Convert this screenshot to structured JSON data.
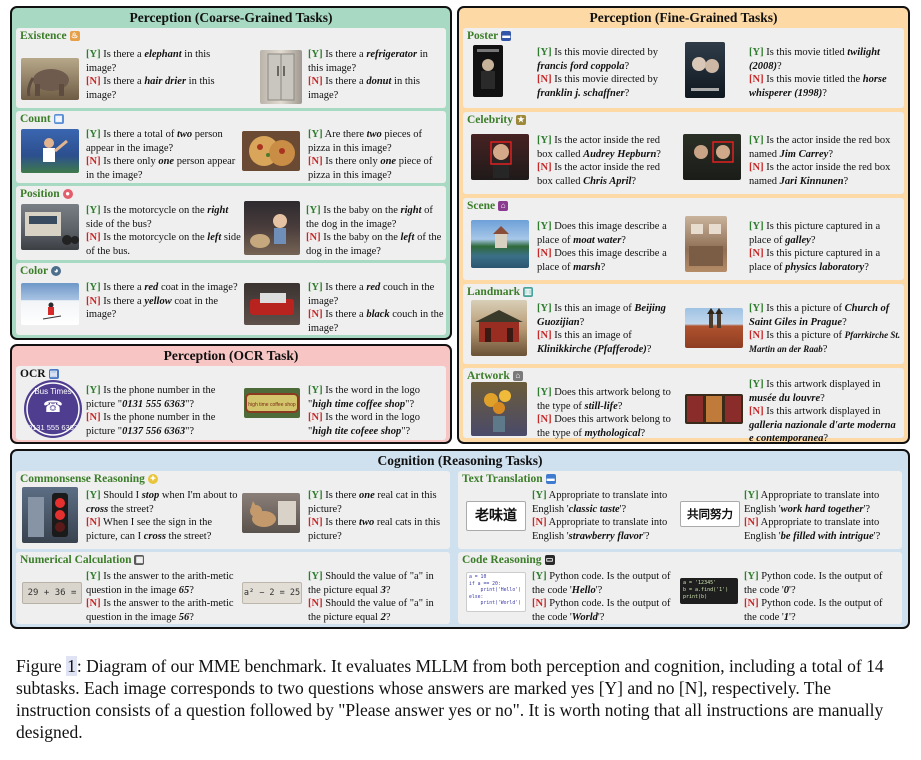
{
  "panels": {
    "coarse": {
      "title": "Perception (Coarse-Grained Tasks)",
      "bg": "#a8d9c3"
    },
    "fine": {
      "title": "Perception (Fine-Grained Tasks)",
      "bg": "#fcd9a5"
    },
    "ocr": {
      "title": "Perception (OCR Task)",
      "bg": "#f7c6c4"
    },
    "cognition": {
      "title": "Cognition (Reasoning Tasks)",
      "bg": "#cfe0ef"
    }
  },
  "tags": {
    "y": "[Y]",
    "n": "[N]"
  },
  "existence": {
    "name": "Existence",
    "a": {
      "y1": " Is there a ",
      "yk": "elephant",
      "y2": " in this image?",
      "n1": " Is there a ",
      "nk": "hair drier",
      "n2": " in this image?"
    },
    "b": {
      "y1": " Is there a ",
      "yk": "refrigerator",
      "y2": " in this image?",
      "n1": " Is there a ",
      "nk": "donut",
      "n2": " in this image?"
    }
  },
  "count": {
    "name": "Count",
    "a": {
      "y1": " Is there a total of ",
      "yk": "two",
      "y2": " person appear in the image?",
      "n1": " Is there only ",
      "nk": "one",
      "n2": " person appear in the image?"
    },
    "b": {
      "y1": " Are there ",
      "yk": "two",
      "y2": " pieces of pizza in this image?",
      "n1": " Is there only ",
      "nk": "one",
      "n2": " piece of pizza in this image?"
    }
  },
  "position": {
    "name": "Position",
    "a": {
      "y1": " Is the motorcycle on the ",
      "yk": "right",
      "y2": " side of the bus?",
      "n1": " Is the motorcycle on the ",
      "nk": "left",
      "n2": " side of the bus."
    },
    "b": {
      "y1": " Is the baby on the ",
      "yk": "right",
      "y2": " of the dog in the image?",
      "n1": " Is the baby on the ",
      "nk": "left",
      "n2": " of the dog in the image?"
    }
  },
  "color": {
    "name": "Color",
    "a": {
      "y1": " Is there a ",
      "yk": "red",
      "y2": " coat in the image?",
      "n1": " Is there a ",
      "nk": "yellow",
      "n2": " coat in the image?"
    },
    "b": {
      "y1": " Is there a ",
      "yk": "red",
      "y2": " couch in the image?",
      "n1": " Is there a ",
      "nk": "black",
      "n2": " couch in the image?"
    }
  },
  "ocr": {
    "name": "OCR",
    "logo_text": "Bus Times",
    "logo_number": "0131 555 6363",
    "sign_text": "high time coffee shop",
    "a": {
      "y1": " Is the phone number in the picture \"",
      "yk": "0131 555 6363",
      "y2": "\"?",
      "n1": " Is the phone number in the picture \"",
      "nk": "0137 556 6363",
      "n2": "\"?"
    },
    "b": {
      "y1": " Is the word in the logo \"",
      "yk": "high time coffee shop",
      "y2": "\"?",
      "n1": " Is the word in the logo \"",
      "nk": "high tite cofeee shop",
      "n2": "\"?"
    }
  },
  "poster": {
    "name": "Poster",
    "a": {
      "y1": " Is this movie directed by ",
      "yk": "francis ford coppola",
      "y2": "?",
      "n1": " Is this movie directed by ",
      "nk": "franklin j. schaffner",
      "n2": "?"
    },
    "b": {
      "y1": " Is this movie titled ",
      "yk": "twilight (2008)",
      "y2": "?",
      "n1": " Is this movie titled the ",
      "nk": "horse whisperer (1998)",
      "n2": "?"
    }
  },
  "celebrity": {
    "name": "Celebrity",
    "a": {
      "y1": " Is the actor inside the red box called ",
      "yk": "Audrey Hepburn",
      "y2": "?",
      "n1": " Is the actor inside the red box called ",
      "nk": "Chris April",
      "n2": "?"
    },
    "b": {
      "y1": " Is the actor inside the red box named ",
      "yk": "Jim Carrey",
      "y2": "?",
      "n1": " Is the actor inside the red box named ",
      "nk": "Jari Kinnunen",
      "n2": "?"
    }
  },
  "scene": {
    "name": "Scene",
    "a": {
      "y1": " Does this image describe a place of ",
      "yk": "moat water",
      "y2": "?",
      "n1": " Does this image describe a place of ",
      "nk": "marsh",
      "n2": "?"
    },
    "b": {
      "y1": " Is this picture captured in a place of ",
      "yk": "galley",
      "y2": "?",
      "n1": " Is this picture captured in a place of ",
      "nk": "physics laboratory",
      "n2": "?"
    }
  },
  "landmark": {
    "name": "Landmark",
    "a": {
      "y1": " Is this an image of ",
      "yk": "Beijing Guozijian",
      "y2": "?",
      "n1": " Is this an image of ",
      "nk": "Klinikkirche (Pfafferode)",
      "n2": "?"
    },
    "b": {
      "y1": " Is this a picture of ",
      "yk": "Church of Saint Giles in Prague",
      "y2": "?",
      "n1": " Is this a picture of ",
      "nk": "Pfarrkirche St. Martin an der Raab",
      "n2": "?"
    }
  },
  "artwork": {
    "name": "Artwork",
    "a": {
      "y1": " Does this artwork belong to the type of ",
      "yk": "still-life",
      "y2": "?",
      "n1": " Does this artwork belong to the type of ",
      "nk": "mythological",
      "n2": "?"
    },
    "b": {
      "y1": " Is this artwork displayed in ",
      "yk": "musée du louvre",
      "y2": "?",
      "n1": " Is this artwork displayed in ",
      "nk": "galleria nazionale d'arte moderna e contemporanea",
      "n2": "?"
    }
  },
  "commonsense": {
    "name": "Commonsense Reasoning",
    "a": {
      "y1": " Should I ",
      "yk": "stop",
      "y2": " when I'm about to ",
      "yk2": "cross",
      "y3": " the street?",
      "n1": " When I see the sign in the picture, can I ",
      "nk": "cross",
      "n2": " the street?"
    },
    "b": {
      "y1": " Is there ",
      "yk": "one",
      "y2": " real cat in this picture?",
      "n1": " Is there ",
      "nk": "two",
      "n2": " real cats in this picture?"
    }
  },
  "numerical": {
    "name": "Numerical Calculation",
    "eq1": "29 + 36 =",
    "eq2": "a² − 2 = 25",
    "a": {
      "y1": " Is the answer to the arith-metic question in the image ",
      "yk": "65",
      "y2": "?",
      "n1": " Is the answer to the arith-metic question in the image ",
      "nk": "56",
      "n2": "?"
    },
    "b": {
      "y1": " Should the value of \"a\" in the picture equal ",
      "yk": "3",
      "y2": "?",
      "n1": " Should the value of \"a\" in the picture equal ",
      "nk": "2",
      "n2": "?"
    }
  },
  "translation": {
    "name": "Text Translation",
    "word1": "老味道",
    "word2": "共同努力",
    "a": {
      "y1": " Appropriate to translate into English '",
      "yk": "classic taste",
      "y2": "'?",
      "n1": " Appropriate to translate into English '",
      "nk": "strawberry flavor",
      "n2": "'?"
    },
    "b": {
      "y1": " Appropriate to translate into English '",
      "yk": "work hard together",
      "y2": "'?",
      "n1": " Appropriate to translate into English '",
      "nk": "be filled with intrigue",
      "n2": "'?"
    }
  },
  "code": {
    "name": "Code Reasoning",
    "code1": [
      "a = 10",
      "if a == 20:",
      "    print('Hello')",
      "else:",
      "    print('World')"
    ],
    "code2": [
      "a = '12345'",
      "b = a.find('1')",
      "print(b)"
    ],
    "a": {
      "y1": " Python code. Is the output of the code '",
      "yk": "Hello",
      "y2": "'?",
      "n1": " Python code. Is the output of the code '",
      "nk": "World",
      "n2": "'?"
    },
    "b": {
      "y1": " Python code. Is the output of the code '",
      "yk": "0",
      "y2": "'?",
      "n1": " Python code. Is the output of the code '",
      "nk": "1",
      "n2": "'?"
    }
  },
  "caption": {
    "lead": "Figure ",
    "ref": "1",
    "rest": ": Diagram of our MME benchmark. It evaluates MLLM from both perception and cognition, including a total of 14 subtasks. Each image corresponds to two questions whose answers are marked yes [Y] and no [N], respectively. The instruction consists of a question followed by \"Please answer yes or no\". It is worth noting that all instructions are manually designed."
  }
}
